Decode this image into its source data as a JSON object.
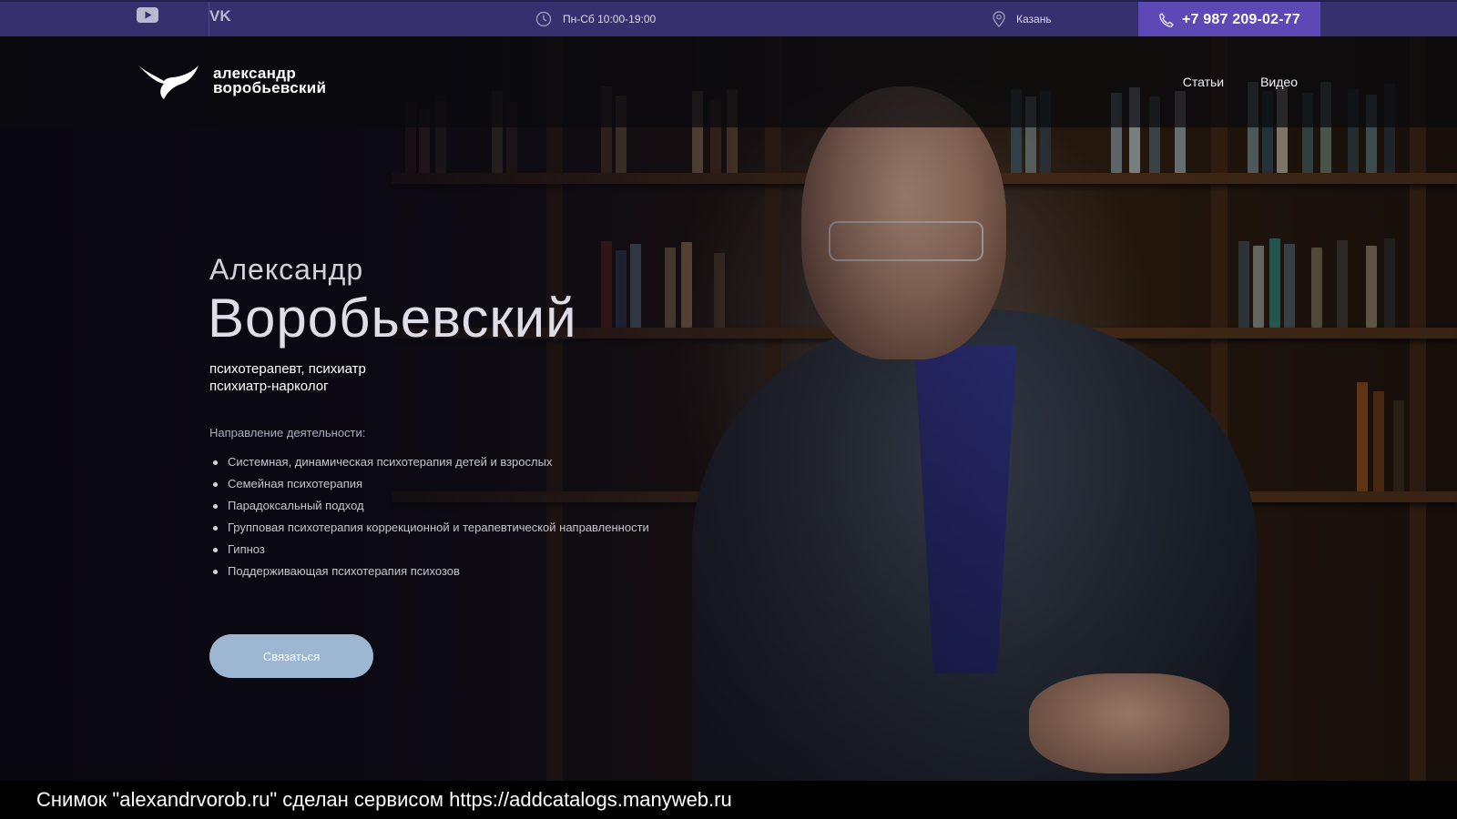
{
  "topbar": {
    "social": [
      {
        "icon": "youtube-icon"
      },
      {
        "icon": "vk-icon"
      }
    ],
    "hours": "Пн-Сб 10:00-19:00",
    "city": "Казань",
    "phone": "+7 987 209-02-77"
  },
  "header": {
    "logo_line1": "александр",
    "logo_line2": "воробьевский",
    "nav": [
      "Статьи",
      "Видео"
    ]
  },
  "hero": {
    "first_name": "Александр",
    "last_name": "Воробьевский",
    "profession_line1": "психотерапевт, психиатр",
    "profession_line2": "психиатр-нарколог",
    "activity_title": "Направление деятельности:",
    "activities": [
      "Системная, динамическая психотерапия детей и взрослых",
      "Семейная психотерапия",
      "Парадоксальный подход",
      "Групповая психотерапия коррекционной и терапевтической направленности",
      "Гипноз",
      "Поддерживающая психотерапия психозов"
    ],
    "cta": "Связаться"
  },
  "caption": "Снимок \"alexandrvorob.ru\" сделан сервисом https://addcatalogs.manyweb.ru",
  "colors": {
    "topbar_bg": "#36306e",
    "phone_bg": "#5c49b6",
    "cta_bg": "#9db7d3"
  }
}
